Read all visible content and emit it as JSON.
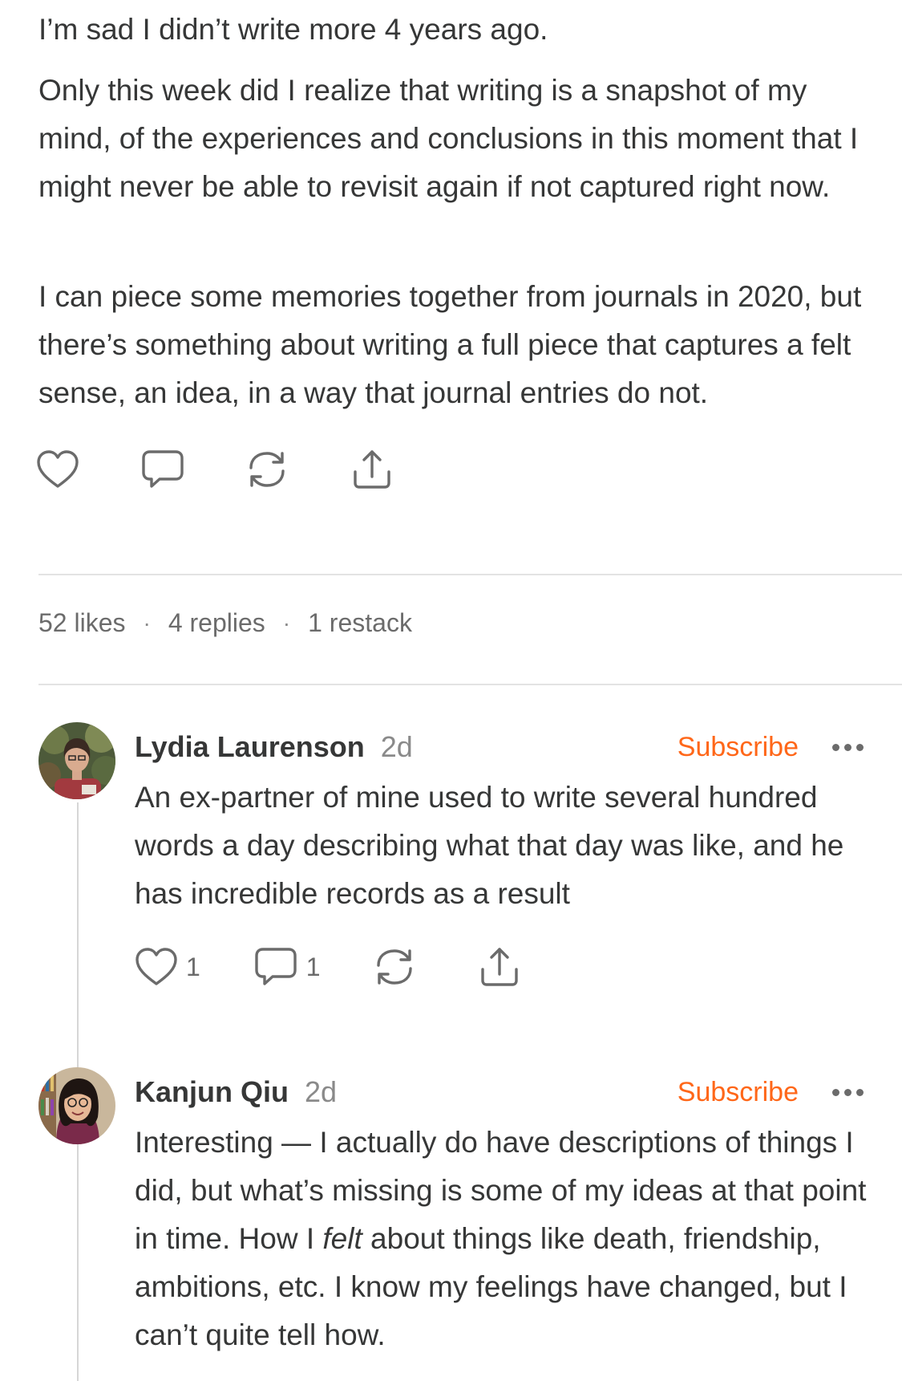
{
  "post": {
    "paragraphs": [
      "I’m sad I didn’t write more 4 years ago.",
      "Only this week did I realize that writing is a snapshot of my mind, of the experiences and conclusions in this moment that I might never be able to revisit again if not captured right now.",
      "I can piece some memories together from journals in 2020, but there’s something about writing a full piece that captures a felt sense, an idea, in a way that journal entries do not."
    ],
    "stats": {
      "likes": "52 likes",
      "replies": "4 replies",
      "restacks": "1 restack",
      "separator": "·"
    }
  },
  "comments": [
    {
      "name": "Lydia Laurenson",
      "time": "2d",
      "subscribe": "Subscribe",
      "body": "An ex-partner of mine used to write several hundred words a day describing what that day was like, and he has incredible records as a result",
      "like_count": "1",
      "reply_count": "1"
    },
    {
      "name": "Kanjun Qiu",
      "time": "2d",
      "subscribe": "Subscribe",
      "body_before": "Interesting — I actually do have descriptions of things I did, but what’s missing is some of my ideas at that point in time. How I ",
      "body_emphasis": "felt",
      "body_after": " about things like death, friendship, ambitions, etc. I know my feelings have changed, but I can’t quite tell how."
    }
  ],
  "icons": {
    "like": "heart-icon",
    "reply": "comment-bubble-icon",
    "restack": "restack-icon",
    "share": "share-icon",
    "more": "more-dots-icon"
  },
  "colors": {
    "text": "#363737",
    "muted": "#6b6b6b",
    "accent": "#ff6719",
    "divider": "#e3e3e3"
  }
}
